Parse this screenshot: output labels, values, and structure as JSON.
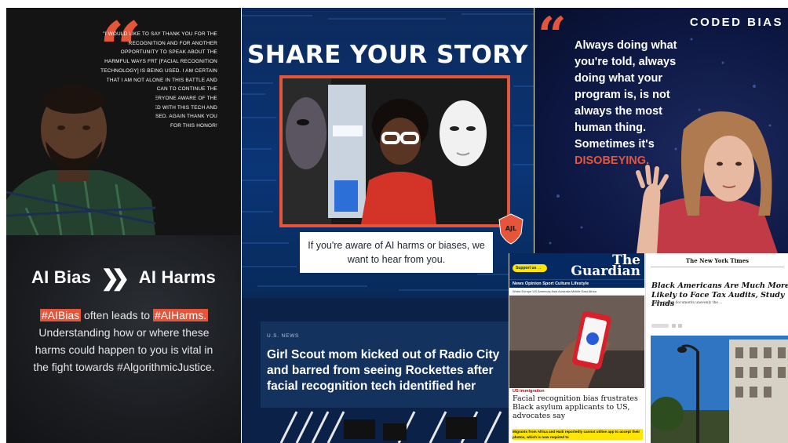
{
  "quote_tile": {
    "text": "\"I would like to say thank you for the recognition and for another opportunity to speak about the harmful ways FRT [facial recognition technology] is being used. I am certain that I am not alone in this battle and will do what I can to continue the push to make everyone aware of the dangers associated with this tech and how it's being used. Again thank you for this honor!"
  },
  "bias_tile": {
    "left": "AI Bias",
    "right": "AI Harms",
    "tag1": "#AIBias",
    "text1": " often leads to ",
    "tag2": "#AIHarms.",
    "text2": " Understanding how or where these harms could happen to you is vital in the fight towards #AlgorithmicJustice."
  },
  "share_tile": {
    "title": "SHARE YOUR STORY",
    "caption": "If you're aware of AI harms or biases, we want to hear from you.",
    "badge": "AJL"
  },
  "news_tile": {
    "section": "U.S.  NEWS",
    "headline": "Girl Scout mom kicked out of Radio City and barred from seeing Rockettes after facial recognition tech identified her"
  },
  "coded_tile": {
    "brand": "CODED BIAS",
    "quote": "Always doing what you're told, always doing what your program is, is not always the most human thing. Sometimes it's ",
    "highlight": "DISOBEYING."
  },
  "guardian_tile": {
    "support": "Support us →",
    "logo_the": "The",
    "logo_name": "Guardian",
    "nav": "News  Opinion  Sport  Culture  Lifestyle",
    "subnav": "World  Europe  US  Americas  Asia  Australia  Middle East  Africa",
    "kicker": "US immigration",
    "headline": "Facial recognition bias frustrates Black asylum applicants to US, advocates say",
    "standfirst": "Migrants from Africa and Haiti reportedly cannot utilise app to accept their photos, which is now required to"
  },
  "nyt_tile": {
    "logo": "The New York Times",
    "headline": "Black Americans Are Much More Likely to Face Tax Audits, Study Finds",
    "dek": "A new report documents unevenly the ..."
  },
  "colors": {
    "accent": "#e4553a",
    "navy": "#0d2a5c",
    "guardian_blue": "#052962",
    "guardian_yellow": "#ffe500"
  }
}
